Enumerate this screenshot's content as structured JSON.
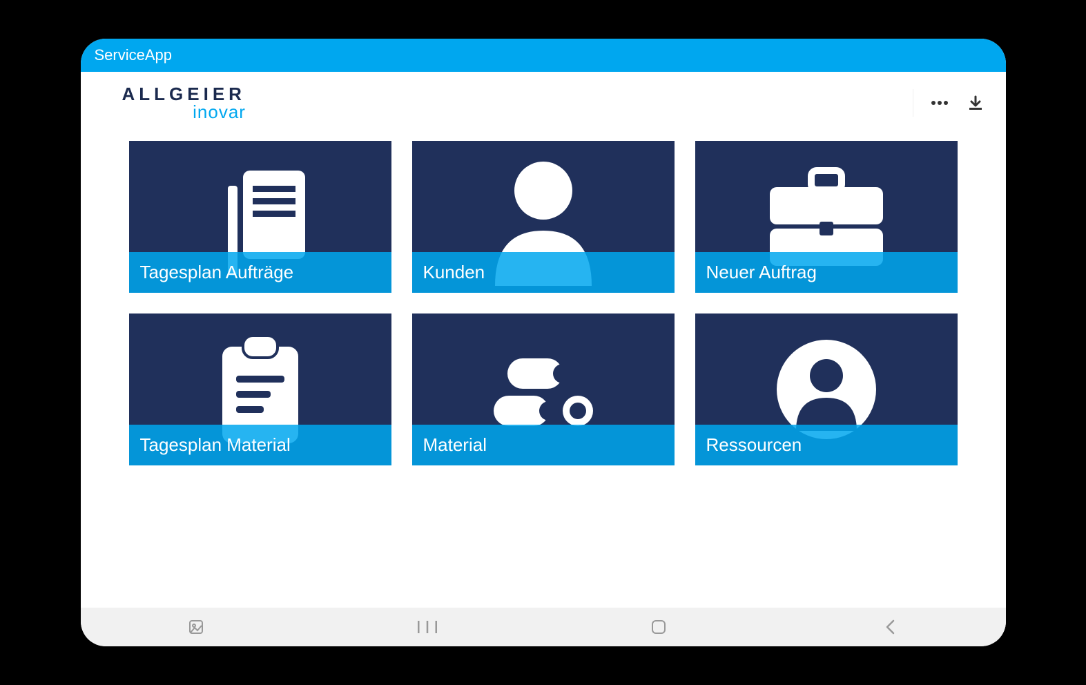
{
  "app": {
    "title": "ServiceApp"
  },
  "logo": {
    "top": "ALLGEIER",
    "bottom": "inovar"
  },
  "header": {
    "icons": {
      "more": "more-icon",
      "download": "download-icon"
    }
  },
  "tiles": [
    {
      "id": "tagesplan-auftraege",
      "label": "Tagesplan Aufträge",
      "icon": "document-pencil-icon"
    },
    {
      "id": "kunden",
      "label": "Kunden",
      "icon": "person-icon"
    },
    {
      "id": "neuer-auftrag",
      "label": "Neuer Auftrag",
      "icon": "briefcase-icon"
    },
    {
      "id": "tagesplan-material",
      "label": "Tagesplan Material",
      "icon": "clipboard-icon"
    },
    {
      "id": "material",
      "label": "Material",
      "icon": "rolls-icon"
    },
    {
      "id": "ressourcen",
      "label": "Ressourcen",
      "icon": "user-circle-icon"
    }
  ],
  "nav": {
    "icons": {
      "screenshot": "screenshot-icon",
      "recents": "recents-icon",
      "home": "home-icon",
      "back": "back-icon"
    }
  },
  "colors": {
    "accent": "#00a7ef",
    "tilebg": "#20305b"
  }
}
